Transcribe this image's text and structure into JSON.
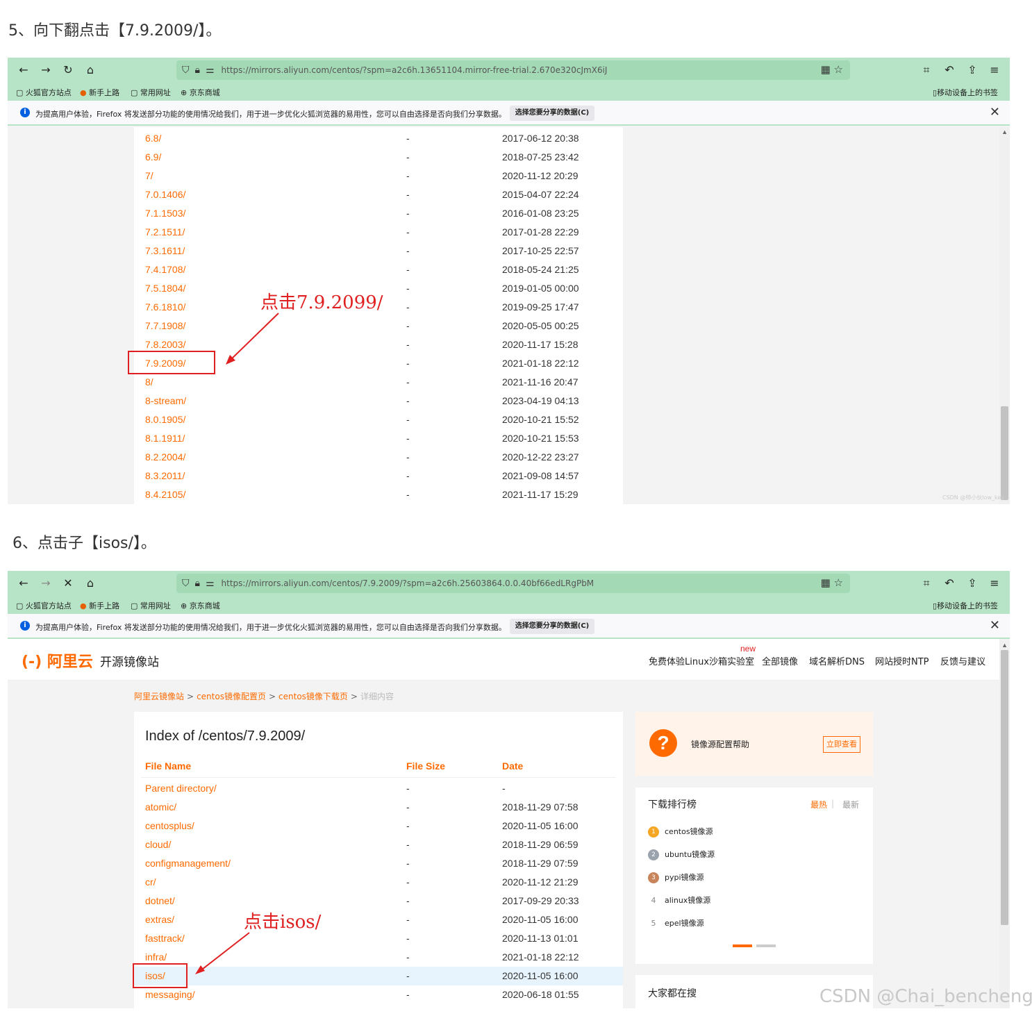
{
  "step5": {
    "title": "5、向下翻点击【7.9.2009/】。",
    "url": "https://mirrors.aliyun.com/centos/?spm=a2c6h.13651104.mirror-free-trial.2.670e320cJmX6iJ",
    "annotation": "点击7.9.2099/",
    "rows": [
      {
        "name": "6.8/",
        "size": "-",
        "date": "2017-06-12 20:38"
      },
      {
        "name": "6.9/",
        "size": "-",
        "date": "2018-07-25 23:42"
      },
      {
        "name": "7/",
        "size": "-",
        "date": "2020-11-12 20:29"
      },
      {
        "name": "7.0.1406/",
        "size": "-",
        "date": "2015-04-07 22:24"
      },
      {
        "name": "7.1.1503/",
        "size": "-",
        "date": "2016-01-08 23:25"
      },
      {
        "name": "7.2.1511/",
        "size": "-",
        "date": "2017-01-28 22:29"
      },
      {
        "name": "7.3.1611/",
        "size": "-",
        "date": "2017-10-25 22:57"
      },
      {
        "name": "7.4.1708/",
        "size": "-",
        "date": "2018-05-24 21:25"
      },
      {
        "name": "7.5.1804/",
        "size": "-",
        "date": "2019-01-05 00:00"
      },
      {
        "name": "7.6.1810/",
        "size": "-",
        "date": "2019-09-25 17:47"
      },
      {
        "name": "7.7.1908/",
        "size": "-",
        "date": "2020-05-05 00:25"
      },
      {
        "name": "7.8.2003/",
        "size": "-",
        "date": "2020-11-17 15:28"
      },
      {
        "name": "7.9.2009/",
        "size": "-",
        "date": "2021-01-18 22:12"
      },
      {
        "name": "8/",
        "size": "-",
        "date": "2021-11-16 20:47"
      },
      {
        "name": "8-stream/",
        "size": "-",
        "date": "2023-04-19 04:13"
      },
      {
        "name": "8.0.1905/",
        "size": "-",
        "date": "2020-10-21 15:52"
      },
      {
        "name": "8.1.1911/",
        "size": "-",
        "date": "2020-10-21 15:53"
      },
      {
        "name": "8.2.2004/",
        "size": "-",
        "date": "2020-12-22 23:27"
      },
      {
        "name": "8.3.2011/",
        "size": "-",
        "date": "2021-09-08 14:57"
      },
      {
        "name": "8.4.2105/",
        "size": "-",
        "date": "2021-11-17 15:29"
      }
    ],
    "small_watermark": "CSDN @帅小伙low_key"
  },
  "step6": {
    "title": "6、点击子【isos/】。",
    "url": "https://mirrors.aliyun.com/centos/7.9.2009/?spm=a2c6h.25603864.0.0.40bf66edLRgPbM",
    "annotation": "点击isos/",
    "logo": "阿里云",
    "site_name": "开源镜像站",
    "nav": {
      "new_badge": "new",
      "items": [
        "免费体验Linux沙箱实验室",
        "全部镜像",
        "域名解析DNS",
        "网站授时NTP",
        "反馈与建议"
      ]
    },
    "breadcrumb": {
      "items": [
        "阿里云镜像站",
        "centos镜像配置页",
        "centos镜像下载页"
      ],
      "current": "详细内容",
      "separator": ">"
    },
    "index_title": "Index of /centos/7.9.2009/",
    "columns": {
      "name": "File Name",
      "size": "File Size",
      "date": "Date"
    },
    "rows": [
      {
        "name": "Parent directory/",
        "size": "-",
        "date": "-"
      },
      {
        "name": "atomic/",
        "size": "-",
        "date": "2018-11-29 07:58"
      },
      {
        "name": "centosplus/",
        "size": "-",
        "date": "2020-11-05 16:00"
      },
      {
        "name": "cloud/",
        "size": "-",
        "date": "2018-11-29 06:59"
      },
      {
        "name": "configmanagement/",
        "size": "-",
        "date": "2018-11-29 07:59"
      },
      {
        "name": "cr/",
        "size": "-",
        "date": "2020-11-12 21:29"
      },
      {
        "name": "dotnet/",
        "size": "-",
        "date": "2017-09-29 20:33"
      },
      {
        "name": "extras/",
        "size": "-",
        "date": "2020-11-05 16:00"
      },
      {
        "name": "fasttrack/",
        "size": "-",
        "date": "2020-11-13 01:01"
      },
      {
        "name": "infra/",
        "size": "-",
        "date": "2021-01-18 22:12"
      },
      {
        "name": "isos/",
        "size": "-",
        "date": "2020-11-05 16:00"
      },
      {
        "name": "messaging/",
        "size": "-",
        "date": "2020-06-18 01:55"
      }
    ],
    "help": {
      "text": "镜像源配置帮助",
      "button": "立即查看"
    },
    "rank": {
      "title": "下载排行榜",
      "tab_hot": "最热",
      "tab_divider": "|",
      "tab_new": "最新",
      "items": [
        {
          "num": "1",
          "name": "centos镜像源"
        },
        {
          "num": "2",
          "name": "ubuntu镜像源"
        },
        {
          "num": "3",
          "name": "pypi镜像源"
        },
        {
          "num": "4",
          "name": "alinux镜像源"
        },
        {
          "num": "5",
          "name": "epel镜像源"
        }
      ]
    },
    "search_title": "大家都在搜"
  },
  "browser": {
    "bookmarks": [
      "火狐官方站点",
      "新手上路",
      "常用网址",
      "京东商城"
    ],
    "mobile_bookmarks": "移动设备上的书签",
    "info_text": "为提高用户体验，Firefox 将发送部分功能的使用情况给我们，用于进一步优化火狐浏览器的易用性，您可以自由选择是否向我们分享数据。",
    "info_button": "选择您要分享的数据(C)"
  },
  "watermark": "CSDN @Chai_bencheng",
  "colors": {
    "accent": "#ff6a00",
    "toolbar": "#b7e4c7",
    "annotation": "#e02020"
  }
}
